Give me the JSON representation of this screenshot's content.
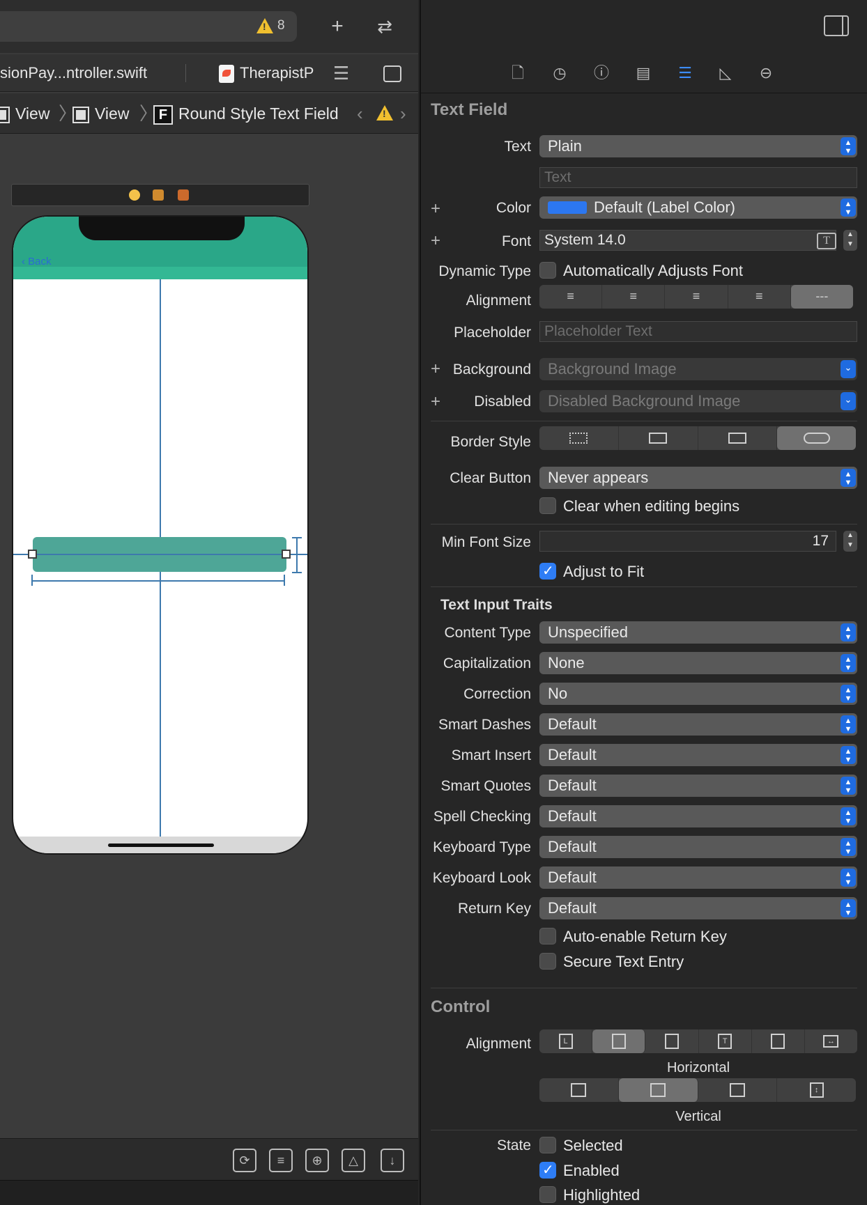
{
  "toolbar": {
    "warning_count": "8",
    "add_label": "+",
    "swap_label": "⇄"
  },
  "tabs": [
    {
      "label": "sionPay...ntroller.swift"
    },
    {
      "label": "TherapistP"
    }
  ],
  "breadcrumb": [
    {
      "label": "View"
    },
    {
      "label": "View"
    },
    {
      "label": "Round Style Text Field",
      "badge": "F"
    }
  ],
  "canvas": {
    "back_label": "Back"
  },
  "inspector": {
    "text_field": {
      "title": "Text Field",
      "text_label": "Text",
      "text_value": "Plain",
      "text_placeholder": "Text",
      "color_label": "Color",
      "color_value": "Default (Label Color)",
      "color_swatch": "#2c77f0",
      "font_label": "Font",
      "font_value": "System 14.0",
      "dynamic_type_label": "Dynamic Type",
      "dynamic_type_check": "Automatically Adjusts Font",
      "alignment_label": "Alignment",
      "placeholder_label": "Placeholder",
      "placeholder_value": "Placeholder Text",
      "background_label": "Background",
      "background_value": "Background Image",
      "disabled_label": "Disabled",
      "disabled_value": "Disabled Background Image",
      "border_style_label": "Border Style",
      "clear_button_label": "Clear Button",
      "clear_button_value": "Never appears",
      "clear_editing_check": "Clear when editing begins",
      "min_font_label": "Min Font Size",
      "min_font_value": "17",
      "adjust_fit_check": "Adjust to Fit"
    },
    "traits": {
      "title": "Text Input Traits",
      "rows": [
        {
          "label": "Content Type",
          "value": "Unspecified"
        },
        {
          "label": "Capitalization",
          "value": "None"
        },
        {
          "label": "Correction",
          "value": "No"
        },
        {
          "label": "Smart Dashes",
          "value": "Default"
        },
        {
          "label": "Smart Insert",
          "value": "Default"
        },
        {
          "label": "Smart Quotes",
          "value": "Default"
        },
        {
          "label": "Spell Checking",
          "value": "Default"
        },
        {
          "label": "Keyboard Type",
          "value": "Default"
        },
        {
          "label": "Keyboard Look",
          "value": "Default"
        },
        {
          "label": "Return Key",
          "value": "Default"
        }
      ],
      "auto_return_check": "Auto-enable Return Key",
      "secure_check": "Secure Text Entry"
    },
    "control": {
      "title": "Control",
      "alignment_label": "Alignment",
      "horizontal_caption": "Horizontal",
      "vertical_caption": "Vertical",
      "state_label": "State",
      "selected_check": "Selected",
      "enabled_check": "Enabled",
      "highlighted_check": "Highlighted"
    }
  }
}
